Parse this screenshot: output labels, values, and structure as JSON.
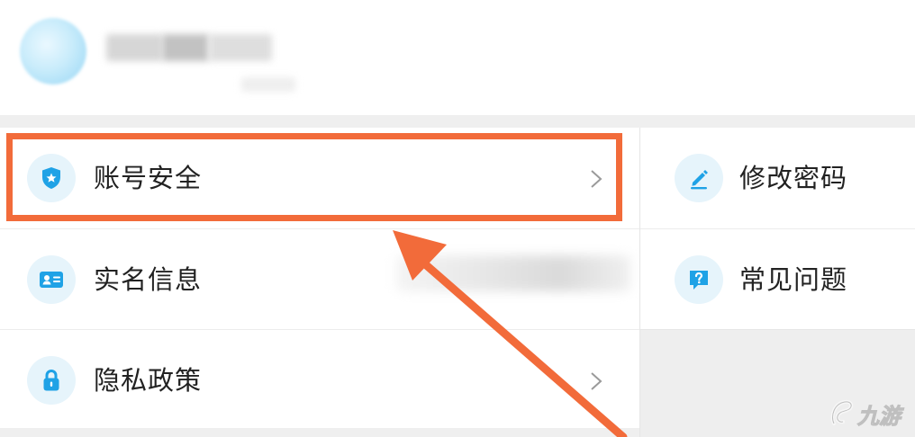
{
  "colors": {
    "accent_blue": "#1fa2e6",
    "icon_bg": "#e6f4fb",
    "highlight": "#f26b3a",
    "divider": "#ececec",
    "section_gap": "#efefef"
  },
  "menu": {
    "left": [
      {
        "label": "账号安全",
        "icon": "shield-star-icon",
        "has_chevron": true
      },
      {
        "label": "实名信息",
        "icon": "id-card-icon",
        "has_chevron": false
      },
      {
        "label": "隐私政策",
        "icon": "lock-icon",
        "has_chevron": true
      }
    ],
    "right": [
      {
        "label": "修改密码",
        "icon": "pencil-icon"
      },
      {
        "label": "常见问题",
        "icon": "question-chat-icon"
      }
    ]
  },
  "watermark": {
    "text": "九游",
    "icon": "jiuyou-logo-icon"
  }
}
